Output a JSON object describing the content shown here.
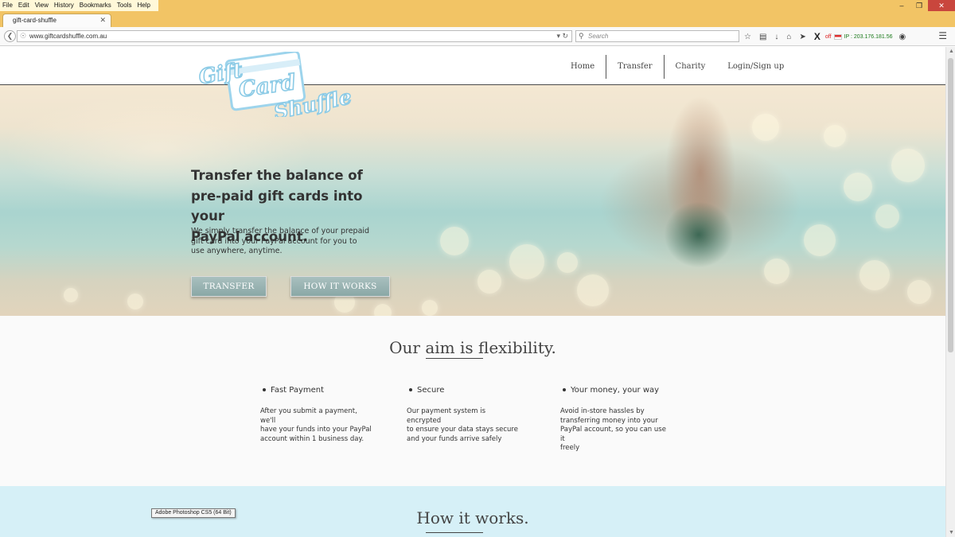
{
  "browser": {
    "menu": [
      "File",
      "Edit",
      "View",
      "History",
      "Bookmarks",
      "Tools",
      "Help"
    ],
    "tab_title": "gift-card-shuffle",
    "url": "www.giftcardshuffle.com.au",
    "search_placeholder": "Search",
    "vpn_status": "off",
    "ip_text": "IP : 203.176.181.56"
  },
  "site": {
    "logo_words": [
      "Gift",
      "Card",
      "Shuffle"
    ],
    "nav": [
      "Home",
      "Transfer",
      "Charity",
      "Login/Sign up"
    ],
    "hero": {
      "title_lines": [
        "Transfer the balance of",
        "pre-paid gift cards into your",
        "PayPal account."
      ],
      "subtitle_lines": [
        "We simply transfer the balance of your prepaid",
        "gift card into your PayPal account for you to",
        "use anywhere, anytime."
      ],
      "btn_transfer": "TRANSFER",
      "btn_how": "HOW IT WORKS"
    },
    "aim": {
      "title": "Our aim is flexibility.",
      "features": [
        {
          "title": "Fast Payment",
          "lines": [
            "After you submit a payment, we'll",
            "have your funds into your PayPal",
            "account within 1 business day."
          ]
        },
        {
          "title": "Secure",
          "lines": [
            "Our payment system is encrypted",
            "to ensure your data stays secure",
            "and your funds arrive safely"
          ]
        },
        {
          "title": "Your money, your way",
          "lines": [
            "Avoid in-store hassles by",
            "transferring money into your",
            "PayPal account, so you can use it",
            "freely"
          ]
        }
      ]
    },
    "how": {
      "title": "How it works."
    }
  },
  "tooltip": "Adobe Photoshop CS5 (64 Bit)",
  "colors": {
    "menubar": "#f2c465",
    "logo_blue": "#9dd4ec",
    "how_section_bg": "#d6f0f7",
    "button_bg": "#9bb6b5"
  }
}
